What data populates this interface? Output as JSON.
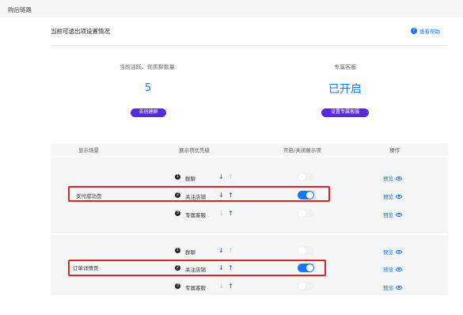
{
  "page": {
    "title": "购后链路"
  },
  "section": {
    "title": "当前可透出项设置情况",
    "help_label": "查看帮助",
    "help_icon": "question-circle-icon"
  },
  "stats": [
    {
      "label": "当前活跃、优质群数量:",
      "value": "5",
      "button": "去创建群"
    },
    {
      "label": "专属客服",
      "value": "已开启",
      "button": "设置专属客服"
    }
  ],
  "table": {
    "headers": [
      "显示场景",
      "展示项优先级",
      "开启/关闭展示项",
      "操作"
    ],
    "groups": [
      {
        "scene": "支付成功页",
        "rows": [
          {
            "num": "1",
            "item": "群聊",
            "up_active": false,
            "down_active": true,
            "toggle": "off",
            "action": "预览"
          },
          {
            "num": "2",
            "item": "关注店铺",
            "up_active": true,
            "down_active": true,
            "toggle": "on",
            "action": "预览"
          },
          {
            "num": "3",
            "item": "专属客服",
            "up_active": true,
            "down_active": false,
            "toggle": "off",
            "action": "预览"
          }
        ]
      },
      {
        "scene": "订单详情页",
        "rows": [
          {
            "num": "1",
            "item": "群聊",
            "up_active": false,
            "down_active": true,
            "toggle": "off",
            "action": "预览"
          },
          {
            "num": "2",
            "item": "关注店铺",
            "up_active": true,
            "down_active": true,
            "toggle": "on",
            "action": "预览"
          },
          {
            "num": "3",
            "item": "专属客服",
            "up_active": true,
            "down_active": false,
            "toggle": "off",
            "action": "预览"
          }
        ]
      }
    ]
  },
  "colors": {
    "accent": "#1677ff",
    "button": "#5b2bd9",
    "highlight": "#e02222"
  }
}
